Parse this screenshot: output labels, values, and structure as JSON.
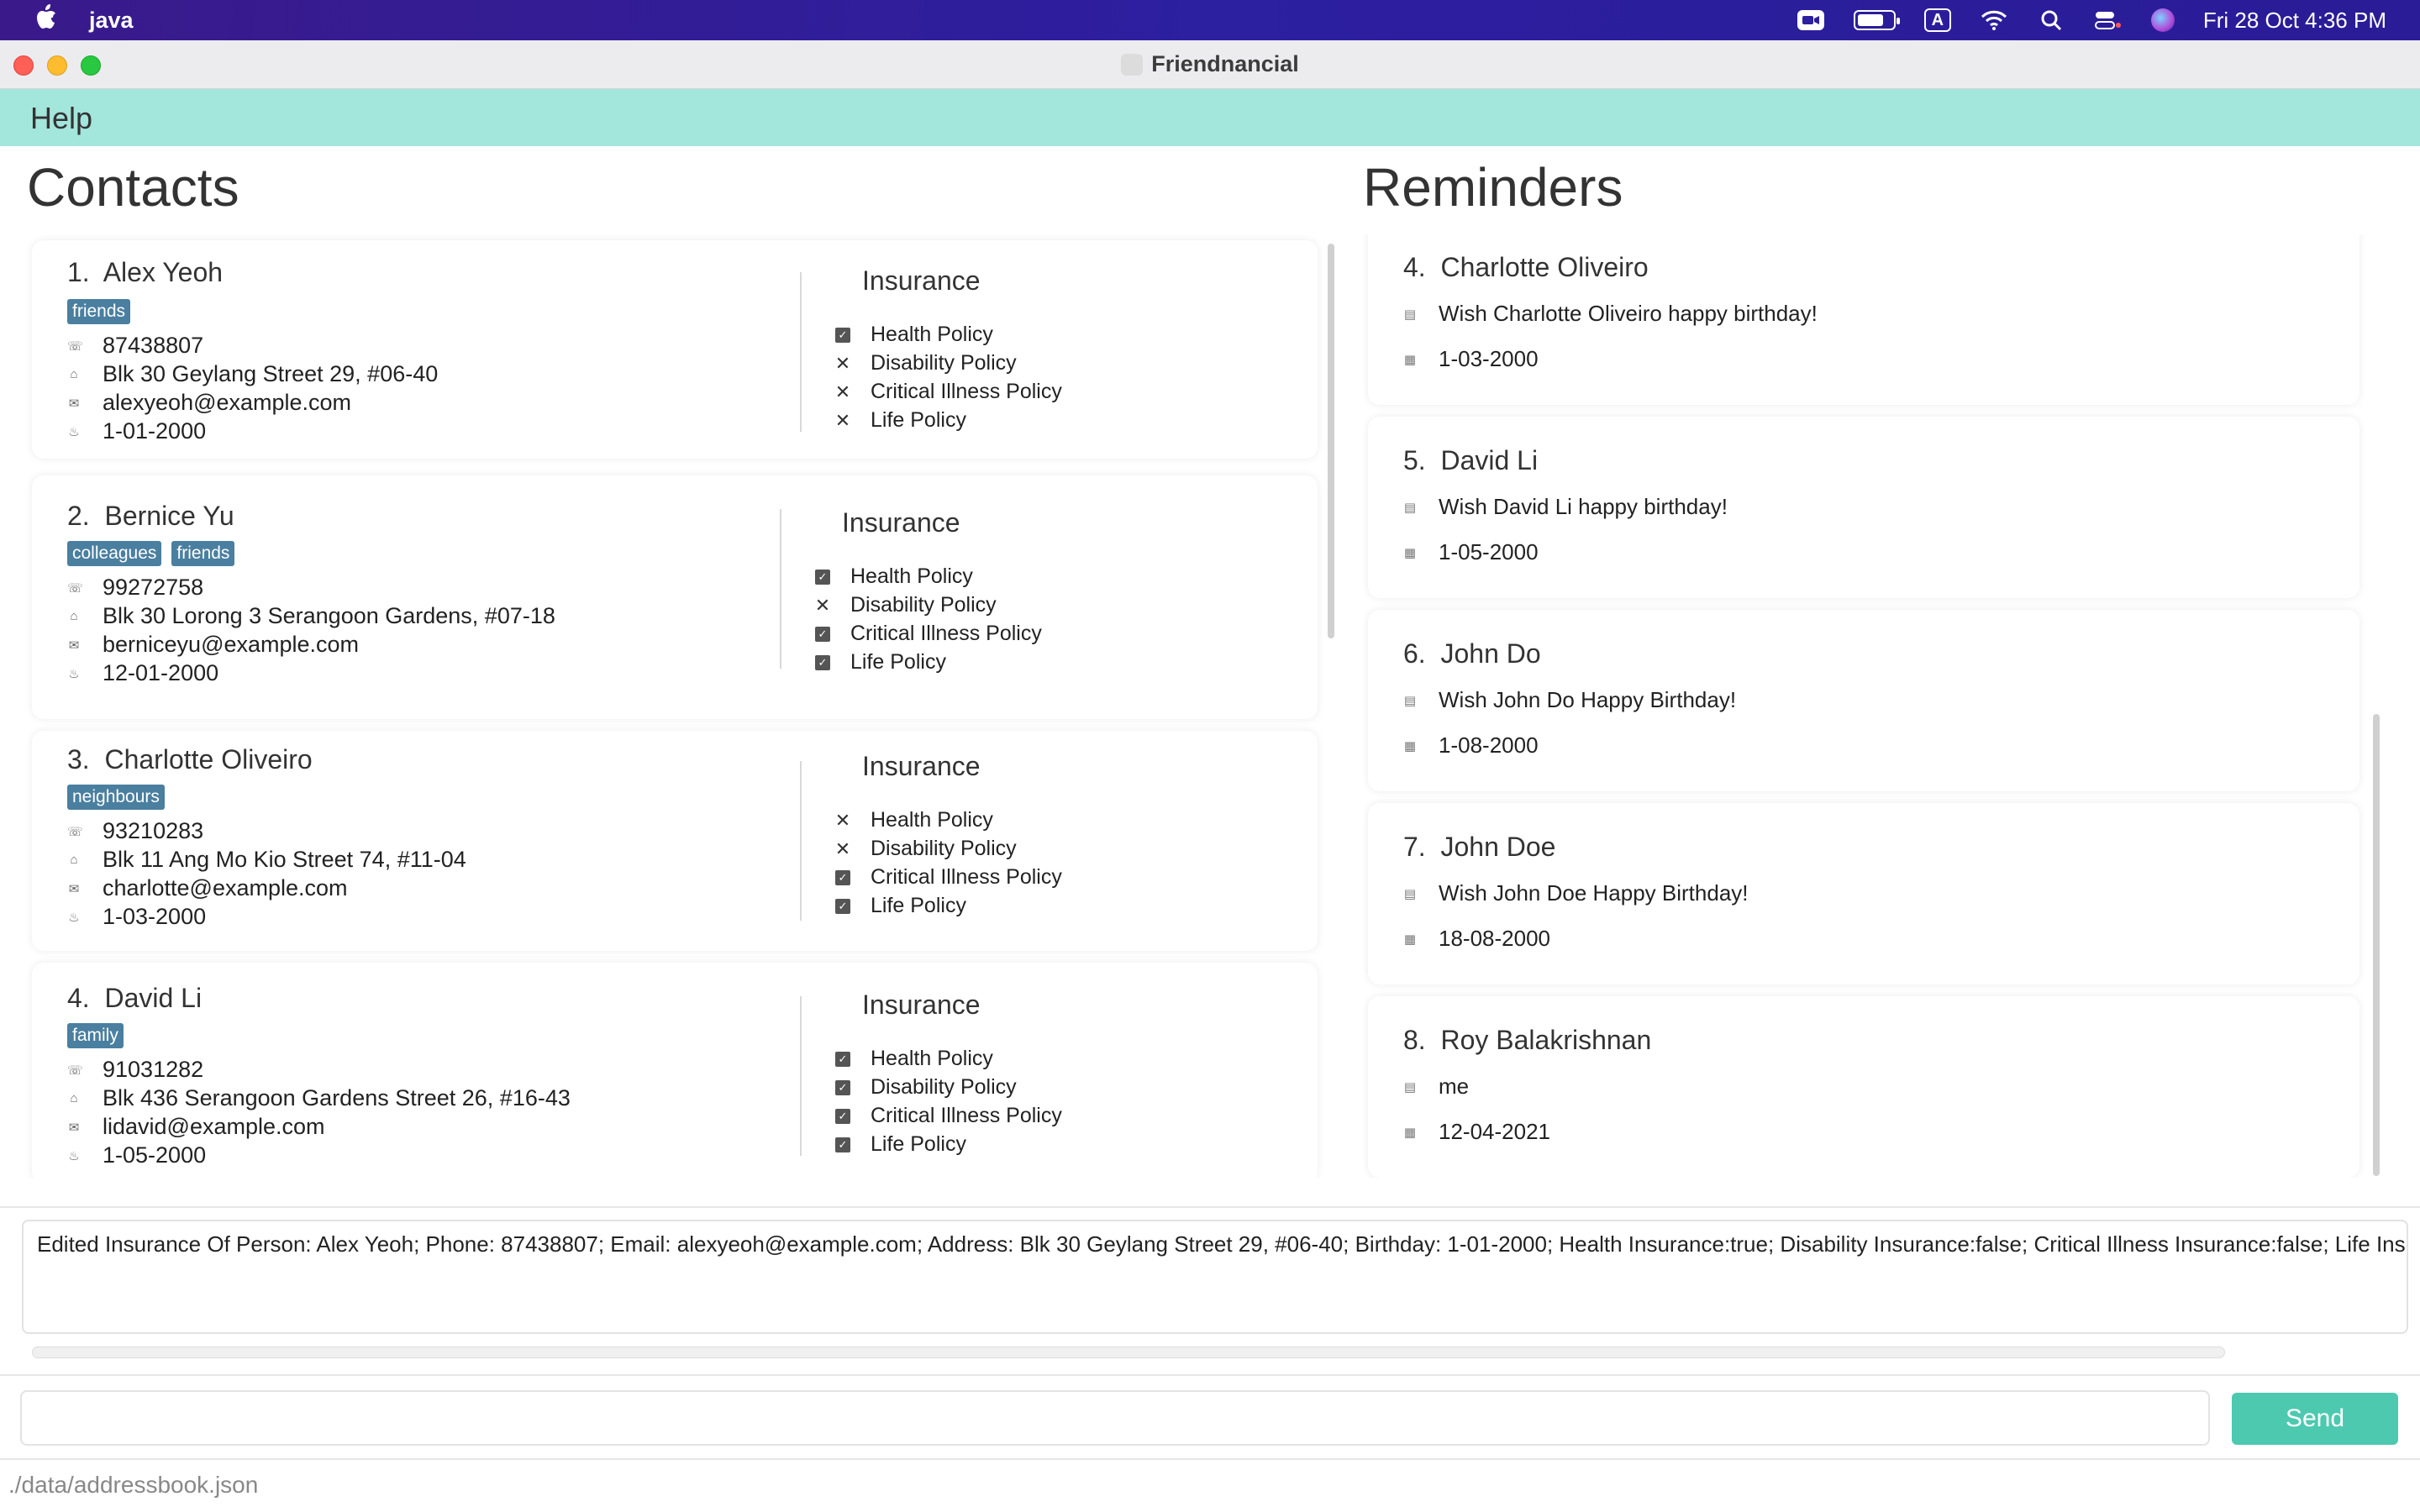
{
  "menubar": {
    "app_name": "java",
    "input_indicator": "A",
    "clock": "Fri 28 Oct  4:36 PM"
  },
  "window": {
    "title": "Friendnancial"
  },
  "menu": {
    "help": "Help"
  },
  "contacts": {
    "heading": "Contacts",
    "insurance_heading": "Insurance",
    "items": [
      {
        "index": "1.",
        "name": "Alex Yeoh",
        "tags": [
          "friends"
        ],
        "phone": "87438807",
        "address": "Blk 30 Geylang Street 29, #06-40",
        "email": "alexyeoh@example.com",
        "birthday": "1-01-2000",
        "policies": [
          {
            "label": "Health Policy",
            "has": true
          },
          {
            "label": "Disability Policy",
            "has": false
          },
          {
            "label": "Critical Illness Policy",
            "has": false
          },
          {
            "label": "Life Policy",
            "has": false
          }
        ]
      },
      {
        "index": "2.",
        "name": "Bernice Yu",
        "tags": [
          "colleagues",
          "friends"
        ],
        "phone": "99272758",
        "address": "Blk 30 Lorong 3 Serangoon Gardens, #07-18",
        "email": "berniceyu@example.com",
        "birthday": "12-01-2000",
        "policies": [
          {
            "label": "Health Policy",
            "has": true
          },
          {
            "label": "Disability Policy",
            "has": false
          },
          {
            "label": "Critical Illness Policy",
            "has": true
          },
          {
            "label": "Life Policy",
            "has": true
          }
        ]
      },
      {
        "index": "3.",
        "name": "Charlotte Oliveiro",
        "tags": [
          "neighbours"
        ],
        "phone": "93210283",
        "address": "Blk 11 Ang Mo Kio Street 74, #11-04",
        "email": "charlotte@example.com",
        "birthday": "1-03-2000",
        "policies": [
          {
            "label": "Health Policy",
            "has": false
          },
          {
            "label": "Disability Policy",
            "has": false
          },
          {
            "label": "Critical Illness Policy",
            "has": true
          },
          {
            "label": "Life Policy",
            "has": true
          }
        ]
      },
      {
        "index": "4.",
        "name": "David Li",
        "tags": [
          "family"
        ],
        "phone": "91031282",
        "address": "Blk 436 Serangoon Gardens Street 26, #16-43",
        "email": "lidavid@example.com",
        "birthday": "1-05-2000",
        "policies": [
          {
            "label": "Health Policy",
            "has": true
          },
          {
            "label": "Disability Policy",
            "has": true
          },
          {
            "label": "Critical Illness Policy",
            "has": true
          },
          {
            "label": "Life Policy",
            "has": true
          }
        ]
      }
    ]
  },
  "reminders": {
    "heading": "Reminders",
    "items": [
      {
        "index": "4.",
        "name": "Charlotte Oliveiro",
        "message": "Wish Charlotte Oliveiro happy birthday!",
        "date": "1-03-2000"
      },
      {
        "index": "5.",
        "name": "David Li",
        "message": "Wish David Li happy birthday!",
        "date": "1-05-2000"
      },
      {
        "index": "6.",
        "name": "John Do",
        "message": "Wish John Do Happy Birthday!",
        "date": "1-08-2000"
      },
      {
        "index": "7.",
        "name": "John Doe",
        "message": "Wish John Doe Happy Birthday!",
        "date": "18-08-2000"
      },
      {
        "index": "8.",
        "name": "Roy Balakrishnan",
        "message": "me",
        "date": "12-04-2021"
      }
    ]
  },
  "result": {
    "text": "Edited Insurance Of Person: Alex Yeoh; Phone: 87438807; Email: alexyeoh@example.com; Address: Blk 30 Geylang Street 29, #06-40; Birthday: 1-01-2000; Health Insurance:true; Disability Insurance:false; Critical Illness Insurance:false; Life Insurance:false"
  },
  "command": {
    "value": "",
    "send_label": "Send"
  },
  "status": {
    "path": "./data/addressbook.json"
  },
  "colors": {
    "accent": "#a3e6dc",
    "send": "#4dc9b0",
    "tag": "#4a7fa0",
    "menubar": "#2c1fa0"
  }
}
